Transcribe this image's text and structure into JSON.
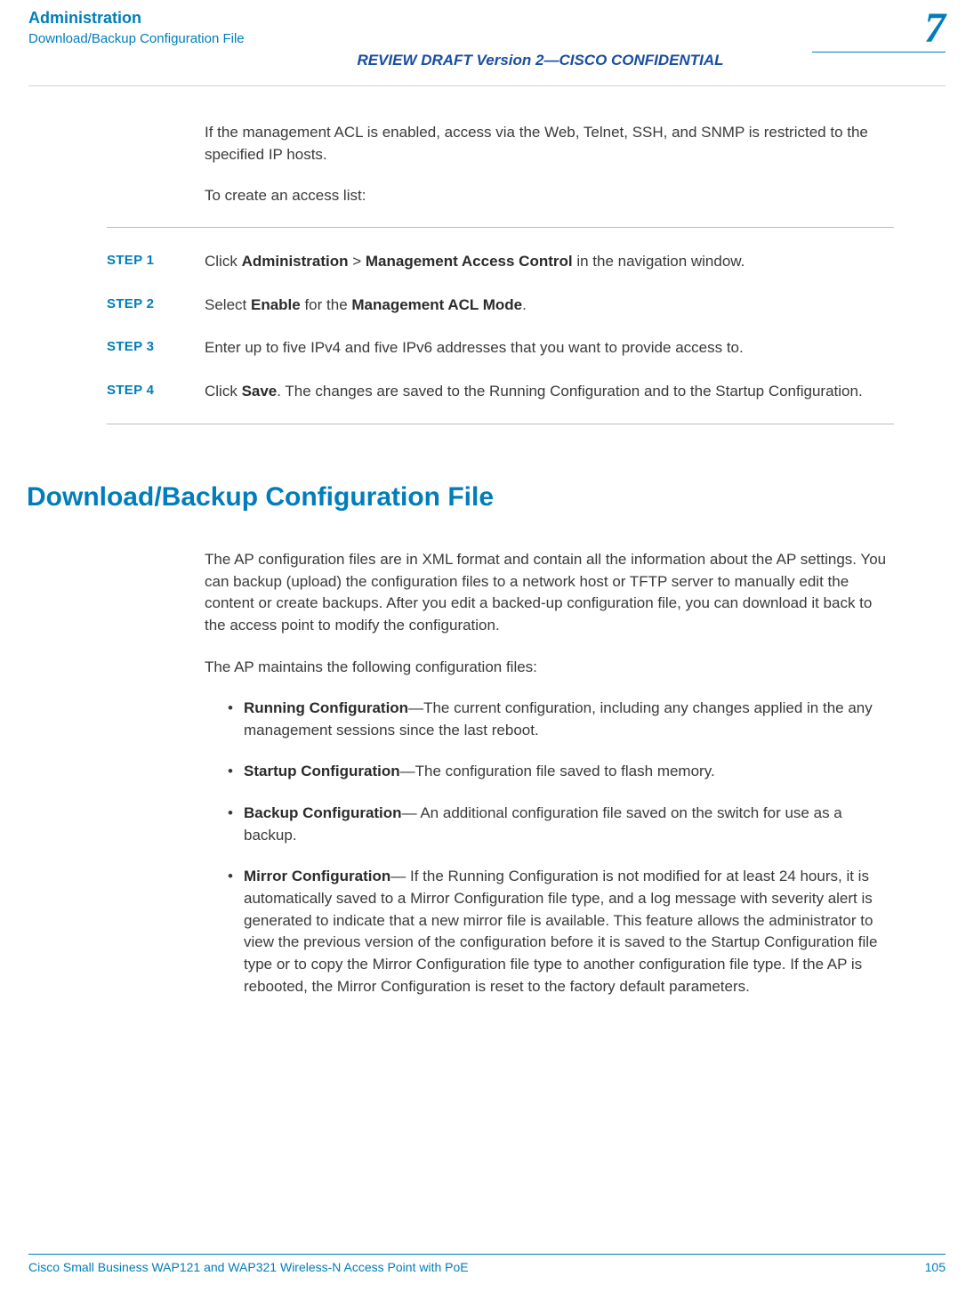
{
  "header": {
    "chapterTitle": "Administration",
    "breadcrumb": "Download/Backup Configuration File",
    "reviewBanner": "REVIEW DRAFT  Version 2—CISCO CONFIDENTIAL",
    "chapterNumber": "7"
  },
  "intro": {
    "p1": "If the management ACL is enabled, access via the Web, Telnet, SSH, and SNMP is restricted to the specified IP hosts.",
    "p2": "To create an access list:"
  },
  "steps": [
    {
      "label": "STEP  1",
      "prefix": "Click ",
      "b1": "Administration",
      "mid": " > ",
      "b2": "Management Access Control",
      "suffix": " in the navigation window."
    },
    {
      "label": "STEP  2",
      "prefix": "Select ",
      "b1": "Enable",
      "mid": " for the ",
      "b2": "Management ACL Mode",
      "suffix": "."
    },
    {
      "label": "STEP  3",
      "text": "Enter up to five IPv4 and five IPv6 addresses that you want to provide access to."
    },
    {
      "label": "STEP  4",
      "prefix": "Click ",
      "b1": "Save",
      "suffix": ". The changes are saved to the Running Configuration and to the Startup Configuration."
    }
  ],
  "section": {
    "heading": "Download/Backup Configuration File",
    "p1": "The AP configuration files are in XML format and contain all the information about the AP settings. You can backup (upload) the configuration files to a network host or TFTP server to manually edit the content or create backups. After you edit a backed-up configuration file, you can download it back to the access point to modify the configuration.",
    "p2": "The AP maintains the following configuration files:",
    "items": [
      {
        "b": "Running Configuration",
        "t": "—The current configuration, including any changes applied in the any management sessions since the last reboot."
      },
      {
        "b": "Startup Configuration",
        "t": "—The configuration file saved to flash memory."
      },
      {
        "b": "Backup Configuration",
        "t": "— An additional configuration file saved on the switch for use as a backup."
      },
      {
        "b": "Mirror Configuration",
        "t": "— If the Running Configuration is not modified for at least 24 hours, it is automatically saved to a Mirror Configuration file type, and a log message with severity alert is generated to indicate that a new mirror file is available. This feature allows the administrator to view the previous version of the configuration before it is saved to the Startup Configuration file type or to copy the Mirror Configuration file type to another configuration file type. If the AP is rebooted, the Mirror Configuration is reset to the factory default parameters."
      }
    ]
  },
  "footer": {
    "left": "Cisco Small Business WAP121 and WAP321 Wireless-N Access Point with PoE",
    "right": "105"
  }
}
